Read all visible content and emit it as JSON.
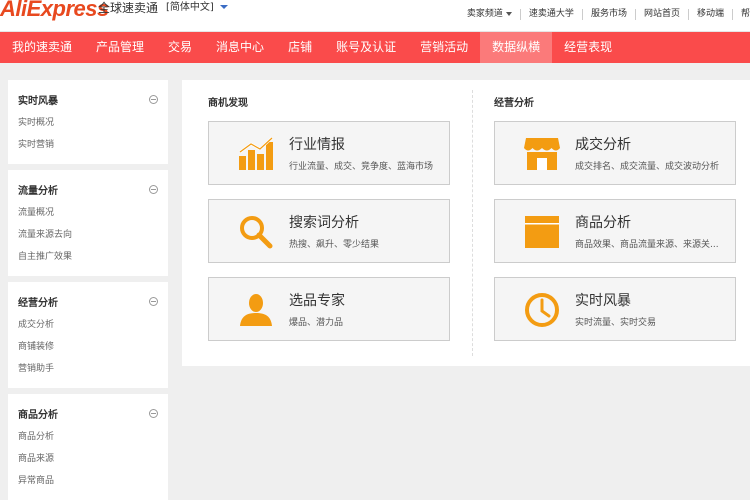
{
  "header": {
    "logo_text": "AliExpress",
    "logo_cn": "全球速卖通",
    "language": "[简体中文]",
    "links": [
      "卖家频道",
      "速卖通大学",
      "服务市场",
      "网站首页",
      "移动端",
      "帮"
    ]
  },
  "nav": {
    "items": [
      "我的速卖通",
      "产品管理",
      "交易",
      "消息中心",
      "店铺",
      "账号及认证",
      "营销活动",
      "数据纵横",
      "经营表现"
    ],
    "active_index": 7
  },
  "sidebar": {
    "sections": [
      {
        "title": "实时风暴",
        "items": [
          "实时概况",
          "实时营销"
        ]
      },
      {
        "title": "流量分析",
        "items": [
          "流量概况",
          "流量来源去向",
          "自主推广效果"
        ]
      },
      {
        "title": "经营分析",
        "items": [
          "成交分析",
          "商铺装修",
          "营销助手"
        ]
      },
      {
        "title": "商品分析",
        "items": [
          "商品分析",
          "商品来源",
          "异常商品"
        ]
      }
    ]
  },
  "main": {
    "left_title": "商机发现",
    "right_title": "经营分析",
    "left_cards": [
      {
        "title": "行业情报",
        "desc": "行业流量、成交、竞争度、蓝海市场",
        "icon": "bar-chart-icon"
      },
      {
        "title": "搜索词分析",
        "desc": "热搜、飙升、零少结果",
        "icon": "magnifier-icon"
      },
      {
        "title": "选品专家",
        "desc": "爆品、潜力品",
        "icon": "person-icon"
      }
    ],
    "right_cards": [
      {
        "title": "成交分析",
        "desc": "成交排名、成交流量、成交波动分析",
        "icon": "storefront-icon"
      },
      {
        "title": "商品分析",
        "desc": "商品效果、商品流量来源、来源关...",
        "icon": "window-icon"
      },
      {
        "title": "实时风暴",
        "desc": "实时流量、实时交易",
        "icon": "clock-icon"
      }
    ]
  },
  "colors": {
    "accent": "#fa4b4b",
    "icon": "#f39c12",
    "logo": "#e8491f"
  }
}
